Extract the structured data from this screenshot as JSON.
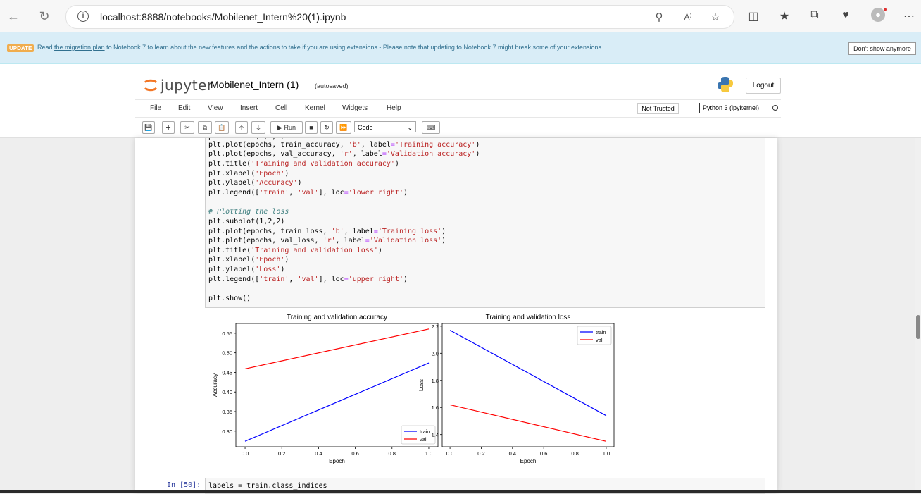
{
  "browser": {
    "url": "localhost:8888/notebooks/Mobilenet_Intern%20(1).ipynb",
    "reader_label": "A⁾"
  },
  "banner": {
    "badge": "UPDATE",
    "text_before": "Read ",
    "link": "the migration plan",
    "text_after": " to Notebook 7 to learn about the new features and the actions to take if you are using extensions - Please note that updating to Notebook 7 might break some of your extensions.",
    "dismiss": "Don't show anymore"
  },
  "header": {
    "logo_text": "jupyter",
    "notebook_name": "Mobilenet_Intern (1)",
    "autosave": "(autosaved)",
    "logout": "Logout"
  },
  "menu": {
    "items": [
      "File",
      "Edit",
      "View",
      "Insert",
      "Cell",
      "Kernel",
      "Widgets",
      "Help"
    ],
    "trust": "Not Trusted",
    "kernel": "Python 3 (ipykernel)"
  },
  "toolbar": {
    "run_label": "Run",
    "cell_type": "Code"
  },
  "code": {
    "lines": [
      "plt.plot(epochs, train_accuracy, 'b', label='Training accuracy')",
      "plt.plot(epochs, val_accuracy, 'r', label='Validation accuracy')",
      "plt.title('Training and validation accuracy')",
      "plt.xlabel('Epoch')",
      "plt.ylabel('Accuracy')",
      "plt.legend(['train', 'val'], loc='lower right')",
      "",
      "# Plotting the loss",
      "plt.subplot(1,2,2)",
      "plt.plot(epochs, train_loss, 'b', label='Training loss')",
      "plt.plot(epochs, val_loss, 'r', label='Validation loss')",
      "plt.title('Training and validation loss')",
      "plt.xlabel('Epoch')",
      "plt.ylabel('Loss')",
      "plt.legend(['train', 'val'], loc='upper right')",
      "",
      "plt.show()"
    ]
  },
  "next_cell": {
    "prompt": "In [50]:",
    "code": "labels = train.class_indices"
  },
  "chart_data": [
    {
      "type": "line",
      "title": "Training and validation accuracy",
      "xlabel": "Epoch",
      "ylabel": "Accuracy",
      "xlim": [
        -0.05,
        1.05
      ],
      "ylim": [
        0.26,
        0.575
      ],
      "xticks": [
        "0.0",
        "0.2",
        "0.4",
        "0.6",
        "0.8",
        "1.0"
      ],
      "yticks": [
        "0.30",
        "0.35",
        "0.40",
        "0.45",
        "0.50",
        "0.55"
      ],
      "legend_loc": "lower right",
      "series": [
        {
          "name": "train",
          "color": "#0000ff",
          "x": [
            0.0,
            1.0
          ],
          "y": [
            0.274,
            0.474
          ]
        },
        {
          "name": "val",
          "color": "#ff0000",
          "x": [
            0.0,
            1.0
          ],
          "y": [
            0.459,
            0.561
          ]
        }
      ]
    },
    {
      "type": "line",
      "title": "Training and validation loss",
      "xlabel": "Epoch",
      "ylabel": "Loss",
      "xlim": [
        -0.05,
        1.05
      ],
      "ylim": [
        1.31,
        2.22
      ],
      "xticks": [
        "0.0",
        "0.2",
        "0.4",
        "0.6",
        "0.8",
        "1.0"
      ],
      "yticks": [
        "1.4",
        "1.6",
        "1.8",
        "2.0",
        "2.2"
      ],
      "legend_loc": "upper right",
      "series": [
        {
          "name": "train",
          "color": "#0000ff",
          "x": [
            0.0,
            1.0
          ],
          "y": [
            2.17,
            1.54
          ]
        },
        {
          "name": "val",
          "color": "#ff0000",
          "x": [
            0.0,
            1.0
          ],
          "y": [
            1.62,
            1.35
          ]
        }
      ]
    }
  ]
}
